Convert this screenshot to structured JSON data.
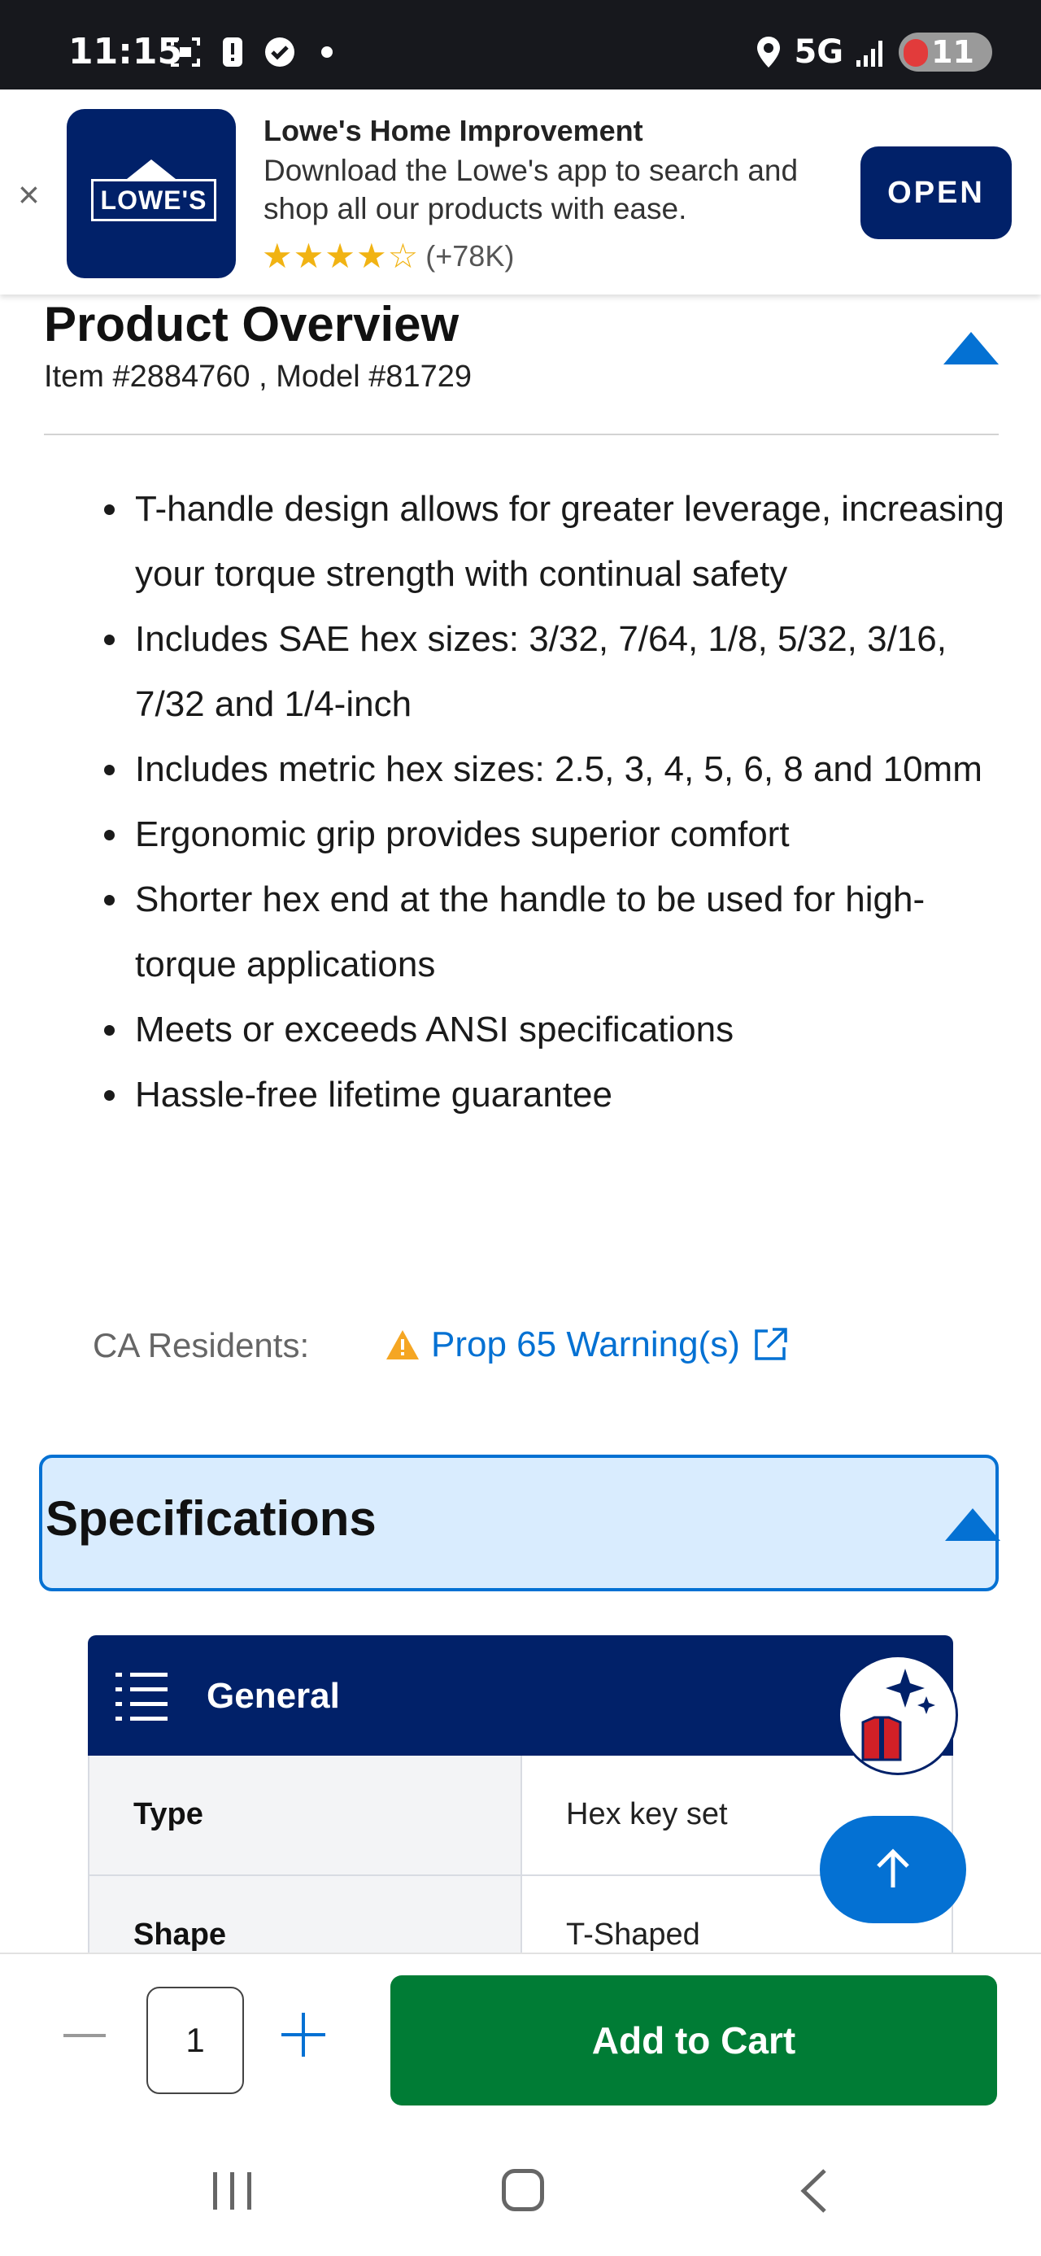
{
  "status_bar": {
    "time": "11:15",
    "network": "5G",
    "battery": "11"
  },
  "app_banner": {
    "close_symbol": "×",
    "logo_text": "LOWE'S",
    "title": "Lowe's Home Improvement",
    "description": "Download the Lowe's app to search and shop all our products with ease.",
    "stars": "★★★★☆",
    "rating_count": "(+78K)",
    "open_label": "OPEN"
  },
  "product_overview": {
    "title": "Product Overview",
    "item_model": "Item #2884760 , Model #81729",
    "features": [
      "T-handle design allows for greater leverage, increasing your torque strength with continual safety",
      "Includes SAE hex sizes: 3/32, 7/64, 1/8, 5/32, 3/16, 7/32 and 1/4-inch",
      "Includes metric hex sizes: 2.5, 3, 4, 5, 6, 8 and 10mm",
      "Ergonomic grip provides superior comfort",
      "Shorter hex end at the handle to be used for high-torque applications",
      "Meets or exceeds ANSI specifications",
      "Hassle-free lifetime guarantee"
    ],
    "ca_label": "CA Residents:",
    "prop65_link": "Prop 65 Warning(s)"
  },
  "specifications": {
    "title": "Specifications",
    "general_title": "General",
    "rows": [
      {
        "key": "Type",
        "value": "Hex key set"
      },
      {
        "key": "Shape",
        "value": "T-Shaped"
      }
    ]
  },
  "cart": {
    "minus_symbol": "—",
    "quantity": "1",
    "add_label": "Add to Cart"
  },
  "colors": {
    "brand_navy": "#012169",
    "link_blue": "#0471d3",
    "cart_green": "#007c35",
    "spec_bg": "#d9ecfe"
  },
  "icons": [
    "close-icon",
    "caret-up-icon",
    "warning-icon",
    "external-link-icon",
    "list-icon",
    "assistant-icon",
    "arrow-up-icon",
    "plus-icon",
    "minus-icon"
  ]
}
